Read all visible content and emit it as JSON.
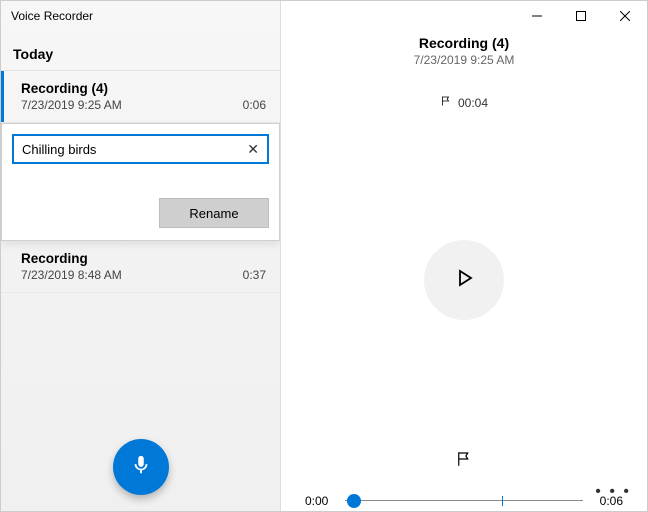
{
  "window": {
    "title": "Voice Recorder",
    "minimize": "—",
    "maximize": "☐",
    "close": "✕"
  },
  "left": {
    "section": "Today",
    "items": [
      {
        "title": "Recording (4)",
        "timestamp": "7/23/2019 9:25 AM",
        "duration": "0:06",
        "selected": true
      },
      {
        "title": "Recording",
        "timestamp": "7/23/2019 8:48 AM",
        "duration": "0:37",
        "selected": false
      }
    ],
    "rename": {
      "value": "Chilling birds",
      "clear": "✕",
      "button": "Rename"
    }
  },
  "detail": {
    "title": "Recording (4)",
    "subtitle": "7/23/2019 9:25 AM",
    "marker": "00:04",
    "seek": {
      "current": "0:00",
      "total": "0:06",
      "position_pct": 2,
      "marker_pct": 66
    },
    "more": "• • •"
  },
  "colors": {
    "accent": "#0078d7"
  }
}
